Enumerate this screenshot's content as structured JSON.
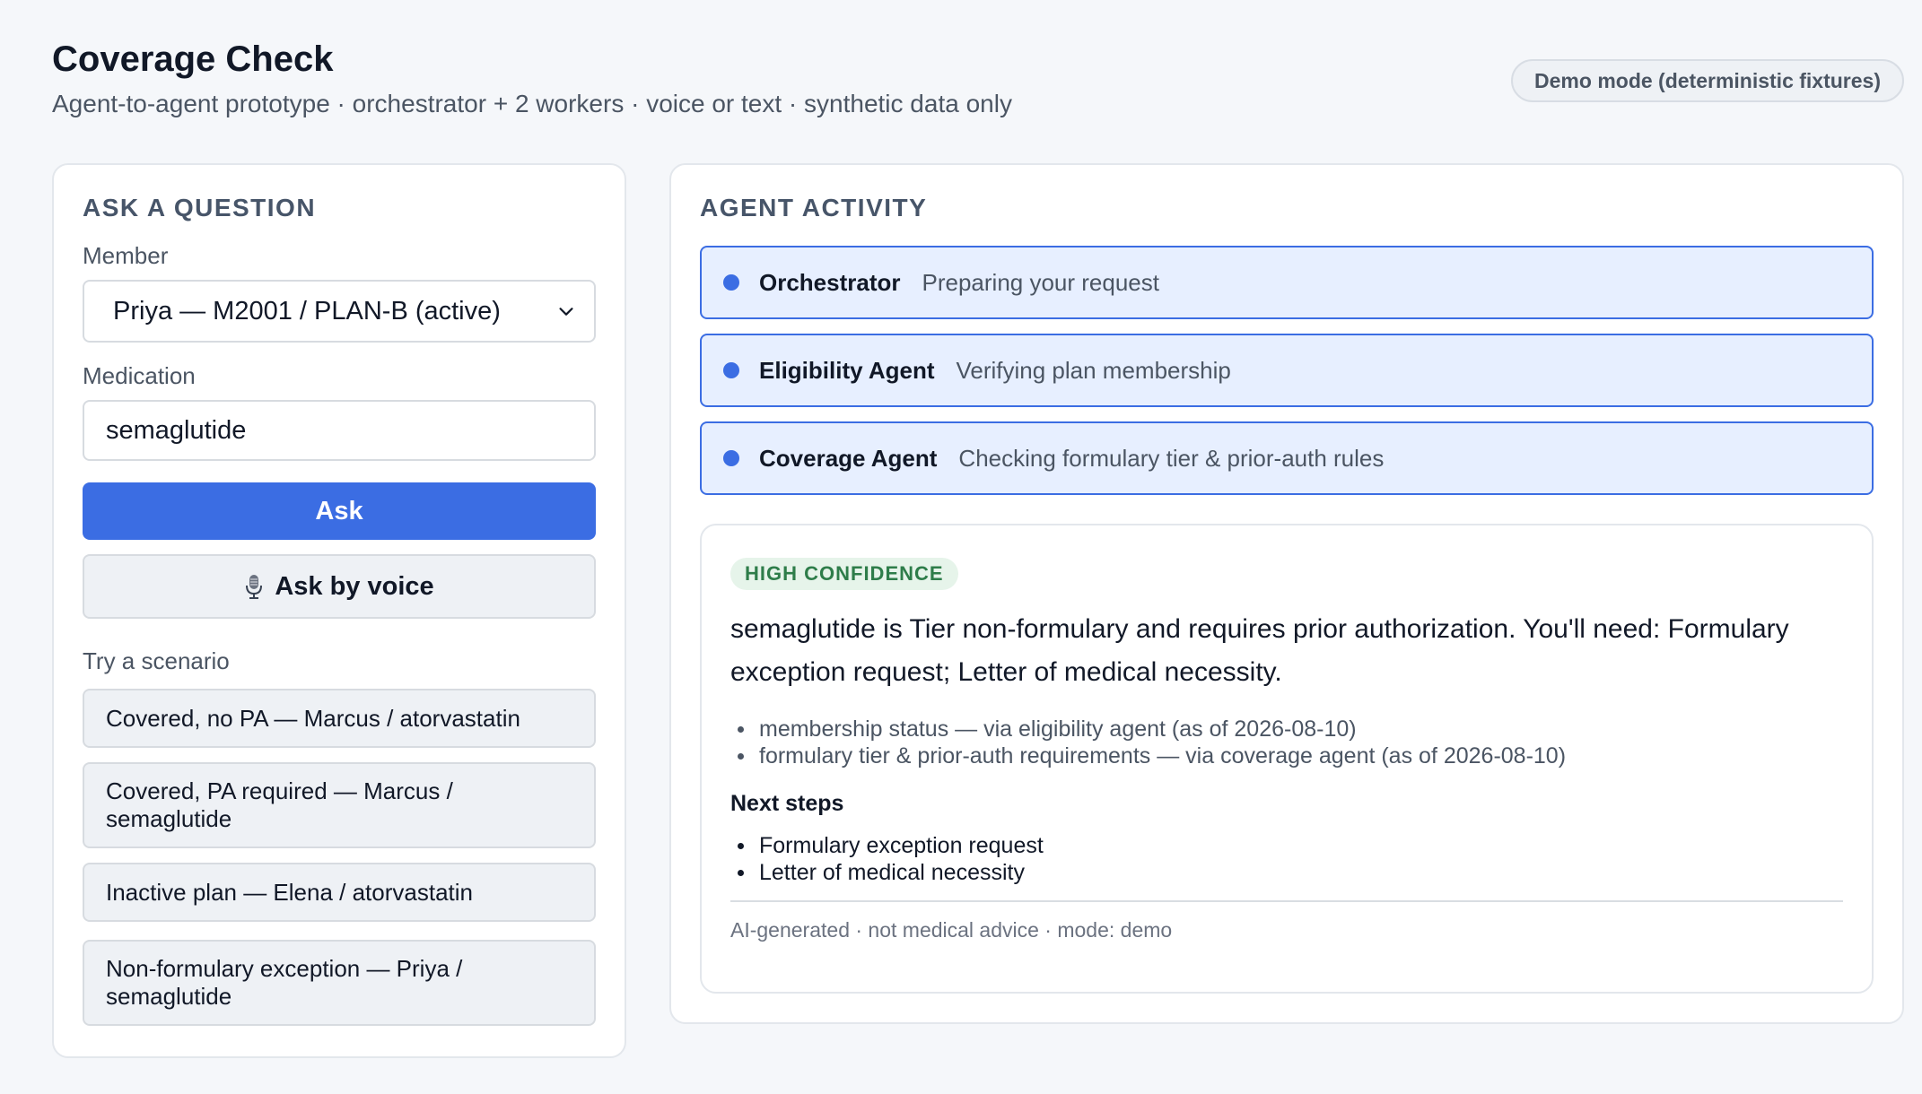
{
  "header": {
    "title": "Coverage Check",
    "subtitle": "Agent-to-agent prototype · orchestrator + 2 workers · voice or text · synthetic data only",
    "mode_badge": "Demo mode (deterministic fixtures)"
  },
  "ask_panel": {
    "heading": "Ask a question",
    "member_label": "Member",
    "member_selected": "Priya — M2001 / PLAN-B (active)",
    "medication_label": "Medication",
    "medication_value": "semaglutide",
    "ask_label": "Ask",
    "voice_label": "Ask by voice",
    "scenario_label": "Try a scenario",
    "scenarios": [
      "Covered, no PA — Marcus / atorvastatin",
      "Covered, PA required — Marcus / semaglutide",
      "Inactive plan — Elena / atorvastatin",
      "Non-formulary exception — Priya / semaglutide"
    ]
  },
  "activity_panel": {
    "heading": "Agent activity",
    "agents": [
      {
        "name": "Orchestrator",
        "status": "Preparing your request"
      },
      {
        "name": "Eligibility Agent",
        "status": "Verifying plan membership"
      },
      {
        "name": "Coverage Agent",
        "status": "Checking formulary tier & prior-auth rules"
      }
    ],
    "accent_color": "#3b6de3"
  },
  "answer": {
    "confidence": "HIGH CONFIDENCE",
    "text": "semaglutide is Tier non-formulary and requires prior authorization. You'll need: Formulary exception request; Letter of medical necessity.",
    "sources": [
      "membership status — via eligibility agent (as of 2026-08-10)",
      "formulary tier & prior-auth requirements — via coverage agent (as of 2026-08-10)"
    ],
    "next_steps_heading": "Next steps",
    "next_steps": [
      "Formulary exception request",
      "Letter of medical necessity"
    ],
    "footer": "AI-generated · not medical advice · mode: demo"
  }
}
